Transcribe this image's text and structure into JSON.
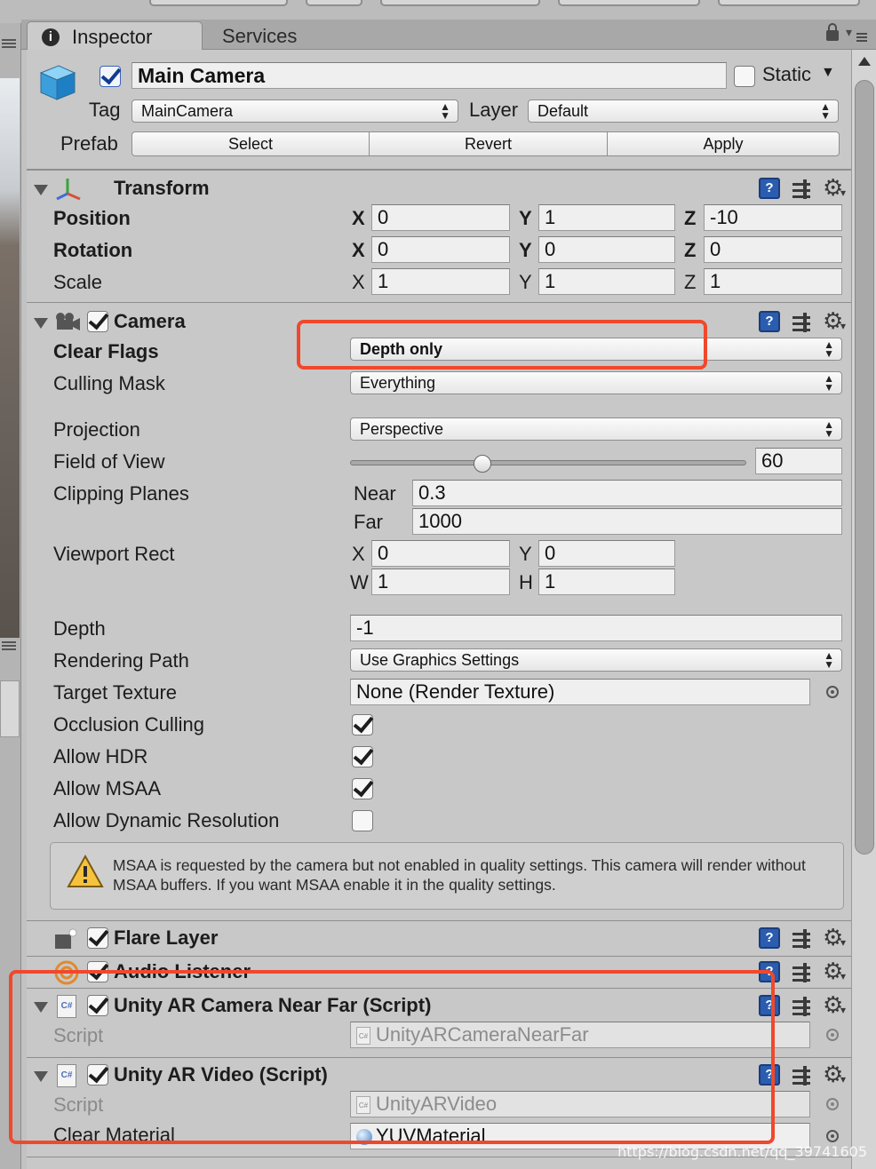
{
  "tabs": {
    "inspector": "Inspector",
    "services": "Services"
  },
  "gameobject": {
    "name": "Main Camera",
    "static_label": "Static",
    "tag_label": "Tag",
    "tag_value": "MainCamera",
    "layer_label": "Layer",
    "layer_value": "Default",
    "prefab_label": "Prefab",
    "prefab_buttons": [
      "Select",
      "Revert",
      "Apply"
    ]
  },
  "transform": {
    "title": "Transform",
    "rows": [
      {
        "label": "Position",
        "x": "0",
        "y": "1",
        "z": "-10"
      },
      {
        "label": "Rotation",
        "x": "0",
        "y": "0",
        "z": "0"
      },
      {
        "label": "Scale",
        "x": "1",
        "y": "1",
        "z": "1"
      }
    ],
    "axis": {
      "x": "X",
      "y": "Y",
      "z": "Z"
    }
  },
  "camera": {
    "title": "Camera",
    "clear_flags_label": "Clear Flags",
    "clear_flags_value": "Depth only",
    "culling_mask_label": "Culling Mask",
    "culling_mask_value": "Everything",
    "projection_label": "Projection",
    "projection_value": "Perspective",
    "fov_label": "Field of View",
    "fov_value": "60",
    "fov_slider_fraction": 0.335,
    "clipping_label": "Clipping Planes",
    "near_label": "Near",
    "near_value": "0.3",
    "far_label": "Far",
    "far_value": "1000",
    "viewport_label": "Viewport Rect",
    "viewport": {
      "x_label": "X",
      "x": "0",
      "y_label": "Y",
      "y": "0",
      "w_label": "W",
      "w": "1",
      "h_label": "H",
      "h": "1"
    },
    "depth_label": "Depth",
    "depth_value": "-1",
    "rendering_path_label": "Rendering Path",
    "rendering_path_value": "Use Graphics Settings",
    "target_texture_label": "Target Texture",
    "target_texture_value": "None (Render Texture)",
    "occlusion_label": "Occlusion Culling",
    "hdr_label": "Allow HDR",
    "msaa_label": "Allow MSAA",
    "dynres_label": "Allow Dynamic Resolution",
    "warning": "MSAA is requested by the camera but not enabled in quality settings. This camera will render without MSAA buffers. If you want MSAA enable it in the quality settings."
  },
  "flare_layer": {
    "title": "Flare Layer"
  },
  "audio_listener": {
    "title": "Audio Listener"
  },
  "near_far_script": {
    "title": "Unity AR Camera Near Far (Script)",
    "script_label": "Script",
    "script_value": "UnityARCameraNearFar"
  },
  "video_script": {
    "title": "Unity AR Video (Script)",
    "script_label": "Script",
    "script_value": "UnityARVideo",
    "clear_material_label": "Clear Material",
    "clear_material_value": "YUVMaterial"
  },
  "icons": {
    "cs_icon": "C#"
  },
  "watermark": "https://blog.csdn.net/qq_39741605",
  "colors": {
    "highlight": "#f0482c",
    "check_blue": "#123a8e"
  }
}
